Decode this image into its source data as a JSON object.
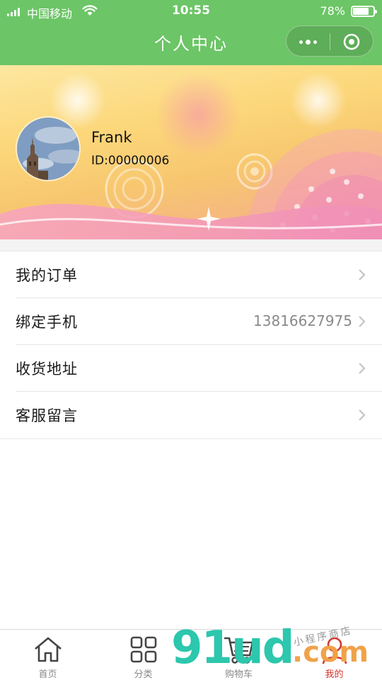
{
  "status_bar": {
    "carrier": "中国移动",
    "time": "10:55",
    "battery_percent": "78%",
    "battery_level": 0.78
  },
  "nav": {
    "title": "个人中心",
    "capsule_icons": [
      "more-icon",
      "close-mini-program-icon"
    ]
  },
  "profile": {
    "name": "Frank",
    "id_text": "ID:00000006"
  },
  "menu": [
    {
      "label": "我的订单",
      "value": ""
    },
    {
      "label": "绑定手机",
      "value": "13816627975"
    },
    {
      "label": "收货地址",
      "value": ""
    },
    {
      "label": "客服留言",
      "value": ""
    }
  ],
  "tabbar": {
    "items": [
      {
        "label": "首页",
        "icon": "home-icon",
        "active": false
      },
      {
        "label": "分类",
        "icon": "category-grid-icon",
        "active": false
      },
      {
        "label": "购物车",
        "icon": "cart-icon",
        "active": false
      },
      {
        "label": "我的",
        "icon": "user-icon",
        "active": true
      }
    ]
  },
  "watermark": {
    "brand": "91ud",
    "domain": ".com",
    "tagline": "小程序商店"
  },
  "colors": {
    "nav_green": "#6cc566",
    "active_tab": "#d5352e",
    "muted_text": "#8a8a8a"
  }
}
